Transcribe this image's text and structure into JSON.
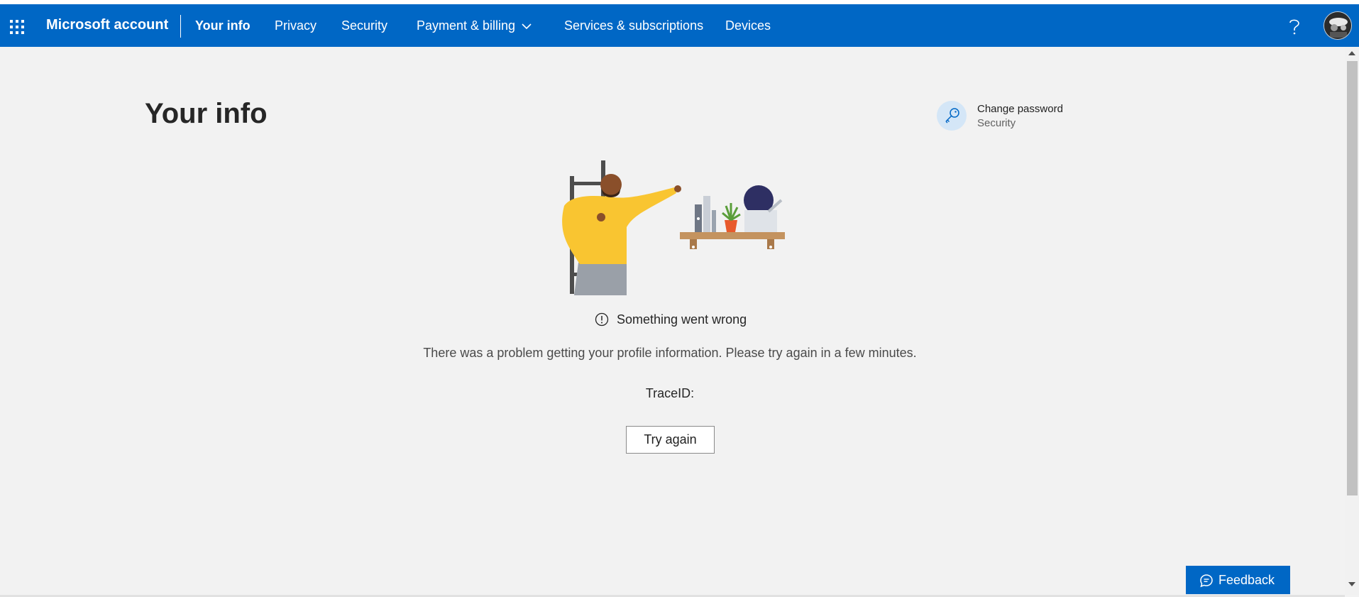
{
  "header": {
    "brand": "Microsoft account",
    "nav": [
      {
        "label": "Your info",
        "active": true
      },
      {
        "label": "Privacy"
      },
      {
        "label": "Security"
      },
      {
        "label": "Payment & billing",
        "has_dropdown": true
      },
      {
        "label": "Services & subscriptions"
      },
      {
        "label": "Devices"
      }
    ],
    "help_label": "?",
    "accent_color": "#0067c5"
  },
  "main": {
    "title": "Your info",
    "quick_link": {
      "title": "Change password",
      "subtitle": "Security",
      "icon": "key-icon"
    },
    "error": {
      "title": "Something went wrong",
      "message": "There was a problem getting your profile information. Please try again in a few minutes.",
      "trace_label": "TraceID:",
      "retry_label": "Try again"
    }
  },
  "feedback": {
    "label": "Feedback",
    "icon": "chat-bubble-icon"
  }
}
